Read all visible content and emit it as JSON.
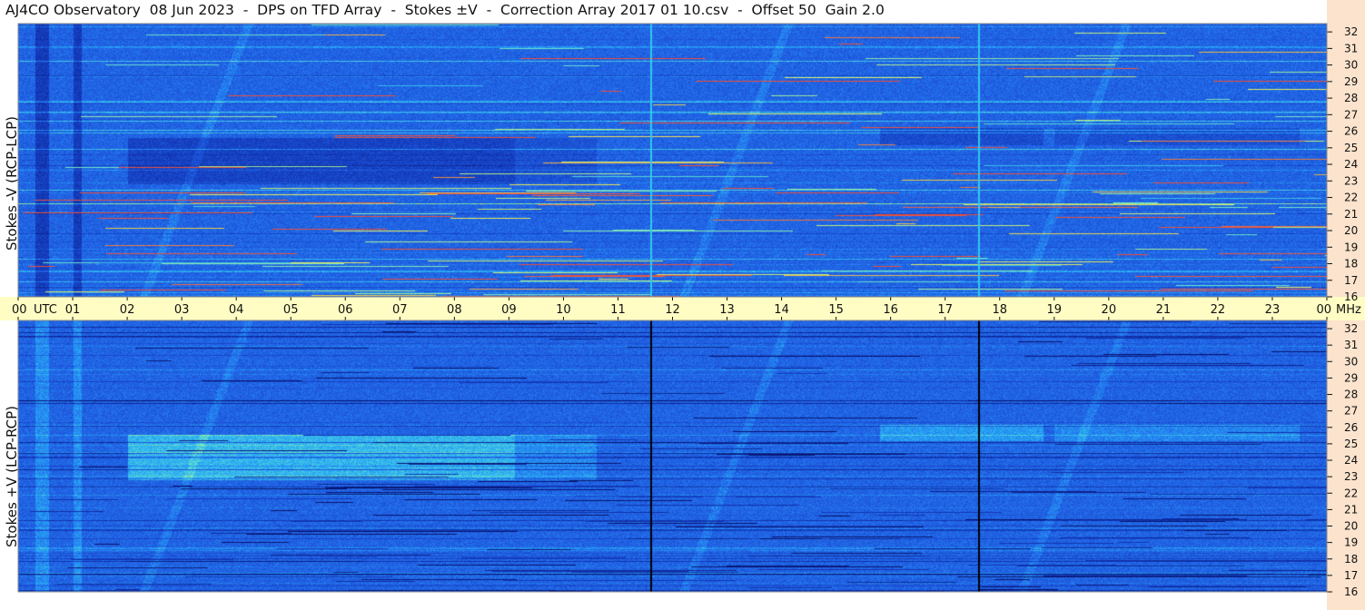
{
  "title": "AJ4CO Observatory  08 Jun 2023  -  DPS on TFD Array  -  Stokes ±V  -  Correction Array 2017 01 10.csv  -  Offset 50  Gain 2.0",
  "colors": {
    "time_axis_bg": "#fffdc4",
    "freq_axis_bg": "#fbe3cd",
    "spectrogram_base": "#1f55c8"
  },
  "chart_data": [
    {
      "type": "heatmap",
      "title": "",
      "ylabel": "Stokes -V  (RCP-LCP)",
      "xlabel": "UTC",
      "x_ticks": [
        "00",
        "01",
        "02",
        "03",
        "04",
        "05",
        "06",
        "07",
        "08",
        "09",
        "10",
        "11",
        "12",
        "13",
        "14",
        "15",
        "16",
        "17",
        "18",
        "19",
        "20",
        "21",
        "22",
        "23",
        "00"
      ],
      "y_ticks": [
        "16",
        "17",
        "18",
        "19",
        "20",
        "21",
        "22",
        "23",
        "24",
        "25",
        "26",
        "27",
        "28",
        "29",
        "30",
        "31",
        "32"
      ],
      "xlim": [
        0,
        24
      ],
      "ylim": [
        16,
        32.5
      ],
      "y_unit": "MHz",
      "colorscale": "dark blue → blue → cyan → yellow → red",
      "vertical_lines_utc": [
        11.6,
        17.6
      ],
      "vertical_line_color": "#33c8f0"
    },
    {
      "type": "heatmap",
      "title": "",
      "ylabel": "Stokes +V  (LCP-RCP)",
      "xlabel": "UTC",
      "x_ticks": [
        "00",
        "01",
        "02",
        "03",
        "04",
        "05",
        "06",
        "07",
        "08",
        "09",
        "10",
        "11",
        "12",
        "13",
        "14",
        "15",
        "16",
        "17",
        "18",
        "19",
        "20",
        "21",
        "22",
        "23",
        "00"
      ],
      "y_ticks": [
        "16",
        "17",
        "18",
        "19",
        "20",
        "21",
        "22",
        "23",
        "24",
        "25",
        "26",
        "27",
        "28",
        "29",
        "30",
        "31",
        "32"
      ],
      "xlim": [
        0,
        24
      ],
      "ylim": [
        16,
        32.5
      ],
      "y_unit": "MHz",
      "colorscale": "dark blue → blue → cyan → yellow → red",
      "vertical_lines_utc": [
        11.6,
        17.6
      ],
      "vertical_line_color": "#000000"
    }
  ],
  "time_axis": {
    "utc_label": "UTC",
    "mhz_label": "MHz"
  }
}
